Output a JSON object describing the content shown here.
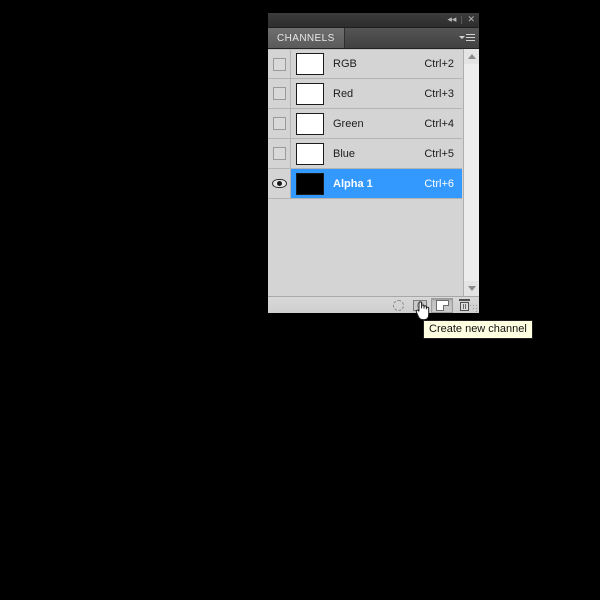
{
  "window": {
    "title_bar": {
      "collapse_label": "◂◂",
      "close_label": "✕"
    },
    "tab": {
      "label": "CHANNELS"
    },
    "panel_menu_icon": "panel-menu-icon"
  },
  "channels": {
    "columns": [
      "visibility",
      "thumbnail",
      "name",
      "shortcut"
    ],
    "rows": [
      {
        "name": "RGB",
        "shortcut": "Ctrl+2",
        "visible": false,
        "selected": false,
        "thumb": "white"
      },
      {
        "name": "Red",
        "shortcut": "Ctrl+3",
        "visible": false,
        "selected": false,
        "thumb": "white"
      },
      {
        "name": "Green",
        "shortcut": "Ctrl+4",
        "visible": false,
        "selected": false,
        "thumb": "white"
      },
      {
        "name": "Blue",
        "shortcut": "Ctrl+5",
        "visible": false,
        "selected": false,
        "thumb": "white"
      },
      {
        "name": "Alpha 1",
        "shortcut": "Ctrl+6",
        "visible": true,
        "selected": true,
        "thumb": "black"
      }
    ]
  },
  "toolbar": {
    "buttons": [
      {
        "name": "load-channel-as-selection",
        "icon": "dashed-circle-icon"
      },
      {
        "name": "save-selection-as-channel",
        "icon": "mask-icon"
      },
      {
        "name": "create-new-channel",
        "icon": "new-page-icon"
      },
      {
        "name": "delete-current-channel",
        "icon": "trash-icon"
      }
    ]
  },
  "tooltip": {
    "text": "Create new channel"
  },
  "scrollbar": {
    "up_arrow": "scroll-up-icon",
    "down_arrow": "scroll-down-icon"
  },
  "colors": {
    "selection_blue": "#3399ff",
    "panel_background": "#d4d4d4",
    "titlebar": "#343434",
    "tab_active": "#636363",
    "tooltip_background": "#ffffe1",
    "canvas_background": "#000000"
  }
}
